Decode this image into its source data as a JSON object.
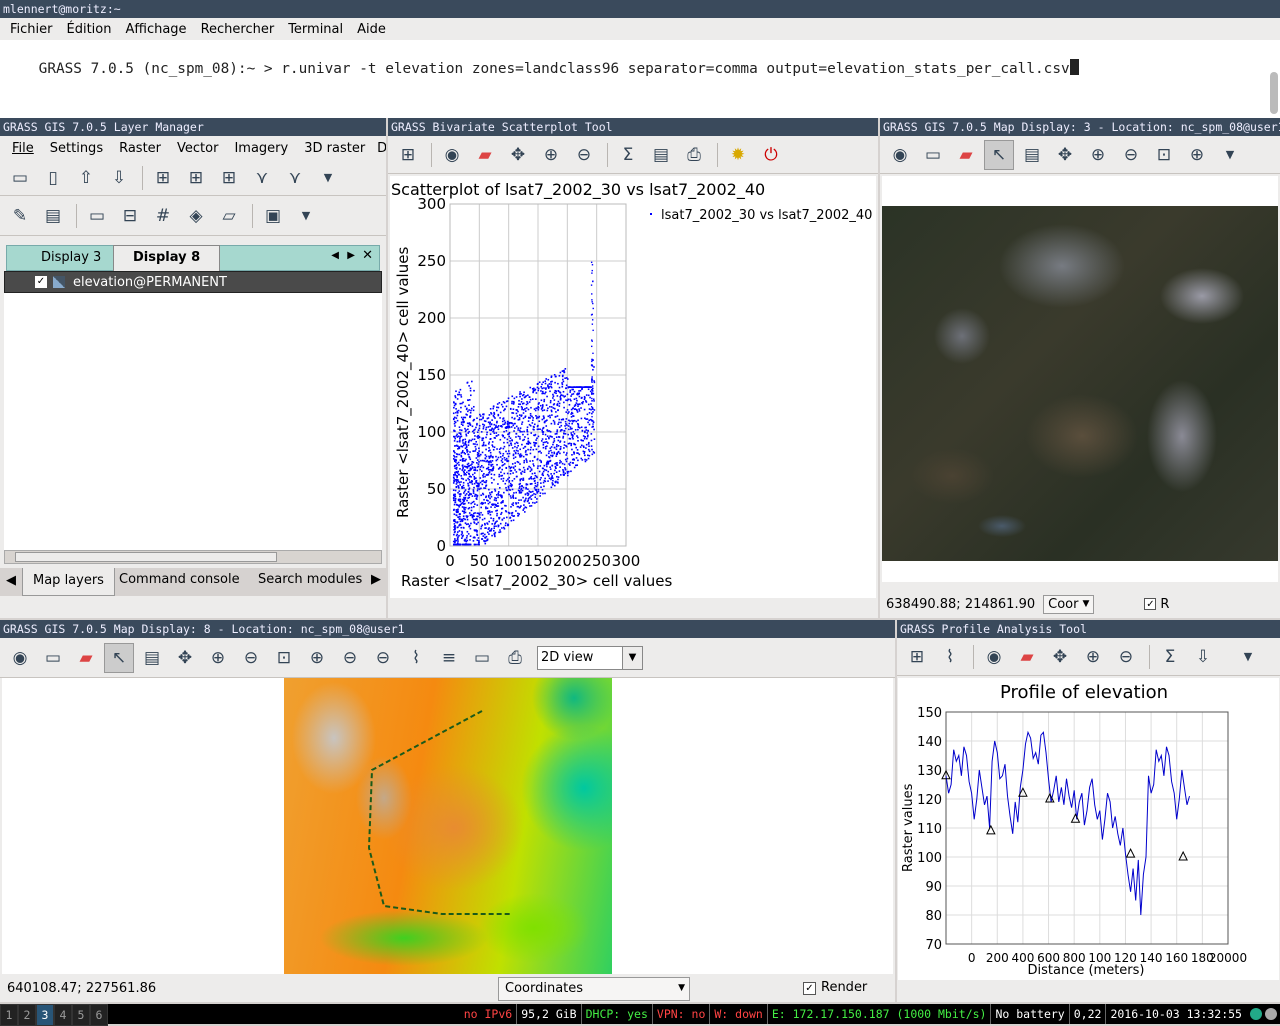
{
  "terminal": {
    "title": "mlennert@moritz:~",
    "menu": [
      "Fichier",
      "Édition",
      "Affichage",
      "Rechercher",
      "Terminal",
      "Aide"
    ],
    "prompt": "GRASS 7.0.5 (nc_spm_08):~ > ",
    "command": "r.univar -t elevation zones=landclass96 separator=comma output=elevation_stats_per_call.csv"
  },
  "layer_manager": {
    "title": "GRASS GIS 7.0.5 Layer Manager",
    "menu": [
      "File",
      "Settings",
      "Raster",
      "Vector",
      "Imagery",
      "3D raster",
      "Dat"
    ],
    "tabs": [
      "Display 3",
      "Display 8"
    ],
    "active_tab": 1,
    "layer": "elevation@PERMANENT",
    "bottom_tabs": [
      "Map layers",
      "Command console",
      "Search modules"
    ],
    "icons_row1": [
      "new-display-icon",
      "new-workspace-icon",
      "open-workspace-icon",
      "save-workspace-icon",
      "add-raster-icon",
      "add-multiple-raster-icon",
      "add-raster-misc-icon",
      "add-vector-icon",
      "add-multiple-vector-icon"
    ],
    "icons_row2": [
      "digitize-icon",
      "attribute-table-icon",
      "georectify-icon",
      "modeler-icon",
      "grid-icon",
      "python-icon",
      "script-icon",
      "settings-icon"
    ]
  },
  "scatter": {
    "title": "GRASS Bivariate Scatterplot Tool",
    "icons": [
      "add-layer-icon",
      "eye-icon",
      "erase-icon",
      "pan-icon",
      "zoom-in-icon",
      "zoom-back-icon",
      "sum-icon",
      "export-icon",
      "print-icon",
      "settings-gear-icon",
      "quit-icon"
    ]
  },
  "chart_data": [
    {
      "type": "scatter",
      "title": "Scatterplot of lsat7_2002_30 vs lsat7_2002_40",
      "xlabel": "Raster <lsat7_2002_30> cell values",
      "ylabel": "Raster <lsat7_2002_40> cell values",
      "series": [
        {
          "name": "lsat7_2002_30 vs lsat7_2002_40"
        }
      ],
      "xticks": [
        "0",
        "50",
        "100",
        "150",
        "200",
        "250",
        "300"
      ],
      "yticks": [
        "0",
        "50",
        "100",
        "150",
        "200",
        "250",
        "300"
      ],
      "xlim": [
        0,
        300
      ],
      "ylim": [
        0,
        300
      ],
      "grid": true,
      "legend": "top-right",
      "color": "#0000ff"
    },
    {
      "type": "line",
      "title": "Profile of elevation",
      "xlabel": "Distance (meters)",
      "ylabel": "Raster values",
      "xticks": [
        "0",
        "200",
        "400",
        "600",
        "800",
        "100",
        "120",
        "140",
        "160",
        "180",
        "20000"
      ],
      "yticks": [
        "70",
        "80",
        "90",
        "100",
        "110",
        "120",
        "130",
        "140",
        "150"
      ],
      "ylim": [
        70,
        150
      ],
      "xlim": [
        -200,
        2000
      ],
      "grid": true,
      "color": "#0000cc",
      "x": [
        -200,
        -180,
        -160,
        -140,
        -120,
        -100,
        -80,
        -60,
        -40,
        -20,
        0,
        20,
        40,
        60,
        80,
        100,
        120,
        140,
        160,
        180,
        200,
        220,
        240,
        260,
        280,
        300,
        320,
        340,
        360,
        380,
        400,
        420,
        440,
        460,
        480,
        500,
        520,
        540,
        560,
        580,
        600,
        620,
        640,
        660,
        680,
        700,
        720,
        740,
        760,
        780,
        800,
        820,
        840,
        860,
        880,
        900,
        920,
        940,
        960,
        980,
        1000,
        1020,
        1040,
        1060,
        1080,
        1100,
        1120,
        1140,
        1160,
        1180,
        1200,
        1220,
        1240,
        1260,
        1280,
        1300,
        1320,
        1340,
        1360,
        1380,
        1400,
        1420,
        1440,
        1460,
        1480,
        1500,
        1520,
        1540,
        1560,
        1580,
        1600,
        1620,
        1640,
        1660,
        1680,
        1700
      ],
      "y": [
        128,
        122,
        125,
        137,
        133,
        135,
        128,
        138,
        135,
        126,
        122,
        113,
        120,
        130,
        124,
        118,
        121,
        110,
        133,
        140,
        136,
        127,
        128,
        132,
        121,
        114,
        108,
        119,
        112,
        124,
        130,
        139,
        143,
        141,
        134,
        136,
        132,
        142,
        143,
        136,
        127,
        119,
        123,
        128,
        119,
        124,
        118,
        127,
        121,
        117,
        123,
        113,
        119,
        122,
        111,
        116,
        124,
        127,
        118,
        113,
        116,
        106,
        113,
        122,
        119,
        110,
        114,
        108,
        104,
        110,
        101,
        94,
        88,
        96,
        85,
        99,
        80,
        94,
        100
      ],
      "markers_x": [
        -200,
        150,
        400,
        610,
        810,
        1240,
        1650
      ],
      "markers_y": [
        128,
        109,
        122,
        120,
        113,
        101,
        100
      ]
    }
  ],
  "map3": {
    "title": "GRASS GIS 7.0.5 Map Display: 3 - Location: nc_spm_08@user1",
    "coords": "638490.88; 214861.90",
    "coords_select": "Coor",
    "render_label": "R",
    "icons": [
      "eye-icon",
      "layer-icon",
      "erase-icon",
      "pointer-icon",
      "query-icon",
      "pan-icon",
      "zoom-in-icon",
      "zoom-out-icon",
      "zoom-extent-icon",
      "zoom-region-icon",
      "chevron-down-icon"
    ]
  },
  "map8": {
    "title": "GRASS GIS 7.0.5 Map Display: 8 - Location: nc_spm_08@user1",
    "coords": "640108.47; 227561.86",
    "coords_select": "Coordinates",
    "render_label": "Render",
    "view_select": "2D view",
    "icons": [
      "eye-icon",
      "layer-icon",
      "erase-icon",
      "pointer-icon",
      "query-icon",
      "pan-icon",
      "zoom-in-icon",
      "zoom-out-icon",
      "zoom-extent-icon",
      "zoom-region-icon",
      "zoom-back-icon",
      "zoom-menu-icon",
      "analyze-icon",
      "overlay-icon",
      "save-icon",
      "print-icon"
    ]
  },
  "profile": {
    "title": "GRASS Profile Analysis Tool",
    "icons": [
      "add-raster-icon",
      "draw-profile-icon",
      "eye-icon",
      "erase-icon",
      "pan-icon",
      "zoom-in-icon",
      "zoom-back-icon",
      "sum-icon",
      "save-icon",
      "chevron-down-icon"
    ]
  },
  "statusbar": {
    "workspaces": [
      "1",
      "2",
      "3",
      "4",
      "5",
      "6"
    ],
    "active_ws": 2,
    "items": [
      {
        "text": "no IPv6",
        "color": "#ff4444"
      },
      {
        "text": "95,2 GiB",
        "color": "#ffffff"
      },
      {
        "text": "DHCP: yes",
        "color": "#44ee44"
      },
      {
        "text": "VPN: no",
        "color": "#ff4444"
      },
      {
        "text": "W: down",
        "color": "#ff4444"
      },
      {
        "text": "E: 172.17.150.187 (1000 Mbit/s)",
        "color": "#44ee44"
      },
      {
        "text": "No battery",
        "color": "#ffffff"
      },
      {
        "text": "0,22",
        "color": "#ffffff"
      },
      {
        "text": "2016-10-03 13:32:55",
        "color": "#ffffff"
      }
    ]
  }
}
